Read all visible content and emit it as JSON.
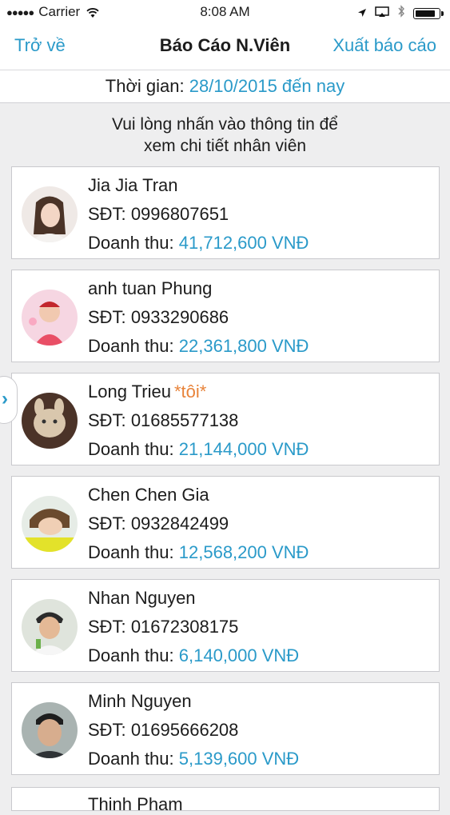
{
  "status_bar": {
    "carrier": "Carrier",
    "time": "8:08 AM",
    "signal_icon": "signal-dots-icon",
    "wifi_icon": "wifi-icon",
    "location_icon": "location-arrow-icon",
    "screen_icon": "airplay-icon",
    "bluetooth_icon": "bluetooth-icon",
    "battery_icon": "battery-icon",
    "battery_level": 0.9
  },
  "nav": {
    "back_label": "Trở về",
    "title": "Báo Cáo N.Viên",
    "export_label": "Xuất báo cáo"
  },
  "period": {
    "label": "Thời gian:",
    "value": "28/10/2015 đến nay"
  },
  "hint": {
    "line1": "Vui lòng nhấn vào thông tin để",
    "line2": "xem chi tiết nhân viên"
  },
  "labels": {
    "phone_prefix": "SĐT:",
    "revenue_prefix": "Doanh thu:"
  },
  "employees": [
    {
      "name": "Jia Jia Tran",
      "me_tag": "",
      "phone": "0996807651",
      "revenue": "41,712,600 VNĐ"
    },
    {
      "name": "anh tuan Phung",
      "me_tag": "",
      "phone": "0933290686",
      "revenue": "22,361,800 VNĐ"
    },
    {
      "name": "Long Trieu",
      "me_tag": "*tôi*",
      "phone": "01685577138",
      "revenue": "21,144,000 VNĐ"
    },
    {
      "name": "Chen Chen Gia",
      "me_tag": "",
      "phone": "0932842499",
      "revenue": "12,568,200 VNĐ"
    },
    {
      "name": "Nhan Nguyen",
      "me_tag": "",
      "phone": "01672308175",
      "revenue": "6,140,000 VNĐ"
    },
    {
      "name": "Minh Nguyen",
      "me_tag": "",
      "phone": "01695666208",
      "revenue": "5,139,600 VNĐ"
    }
  ],
  "partial_employee_name": "Thinh Pham",
  "colors": {
    "accent": "#2a9ac9",
    "me_tag": "#e8833a",
    "background": "#eeeeef"
  }
}
